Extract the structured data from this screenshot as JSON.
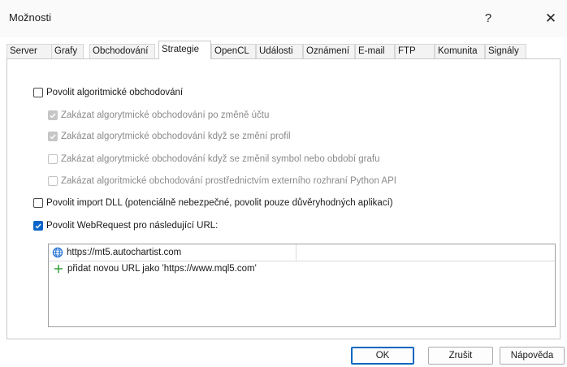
{
  "window": {
    "title": "Možnosti",
    "help_label": "?",
    "close_label": "✕"
  },
  "tabs": [
    {
      "label": "Server"
    },
    {
      "label": "Grafy"
    },
    {
      "label": "Obchodování"
    },
    {
      "label": "Strategie",
      "active": true
    },
    {
      "label": "OpenCL"
    },
    {
      "label": "Události"
    },
    {
      "label": "Oznámení"
    },
    {
      "label": "E-mail"
    },
    {
      "label": "FTP"
    },
    {
      "label": "Komunita"
    },
    {
      "label": "Signály"
    }
  ],
  "options": {
    "allow_algo": {
      "label": "Povolit algoritmické obchodování",
      "checked": false,
      "enabled": true
    },
    "disable_on_account_change": {
      "label": "Zakázat algorytmické obchodování po změně účtu",
      "checked": true,
      "enabled": false
    },
    "disable_on_profile_change": {
      "label": "Zakázat algorytmické obchodování když se změní profil",
      "checked": true,
      "enabled": false
    },
    "disable_on_symbol_change": {
      "label": "Zakázat algorytmické obchodování když se změnil symbol nebo období grafu",
      "checked": false,
      "enabled": false
    },
    "disable_python_api": {
      "label": "Zakázat algoritmické obchodování prostřednictvím externího rozhraní Python API",
      "checked": false,
      "enabled": false
    },
    "allow_dll": {
      "label": "Povolit import DLL (potenciálně nebezpečné, povolit pouze důvěryhodných aplikací)",
      "checked": false,
      "enabled": true
    },
    "allow_webrequest": {
      "label": "Povolit WebRequest pro následující URL:",
      "checked": true,
      "enabled": true
    }
  },
  "url_list": {
    "items": [
      "https://mt5.autochartist.com"
    ],
    "add_hint": "přidat novou URL jako  'https://www.mql5.com'"
  },
  "buttons": {
    "ok": "OK",
    "cancel": "Zrušit",
    "help": "Nápověda"
  },
  "colors": {
    "accent": "#0a64c9",
    "add_icon": "#2e9a2e"
  }
}
